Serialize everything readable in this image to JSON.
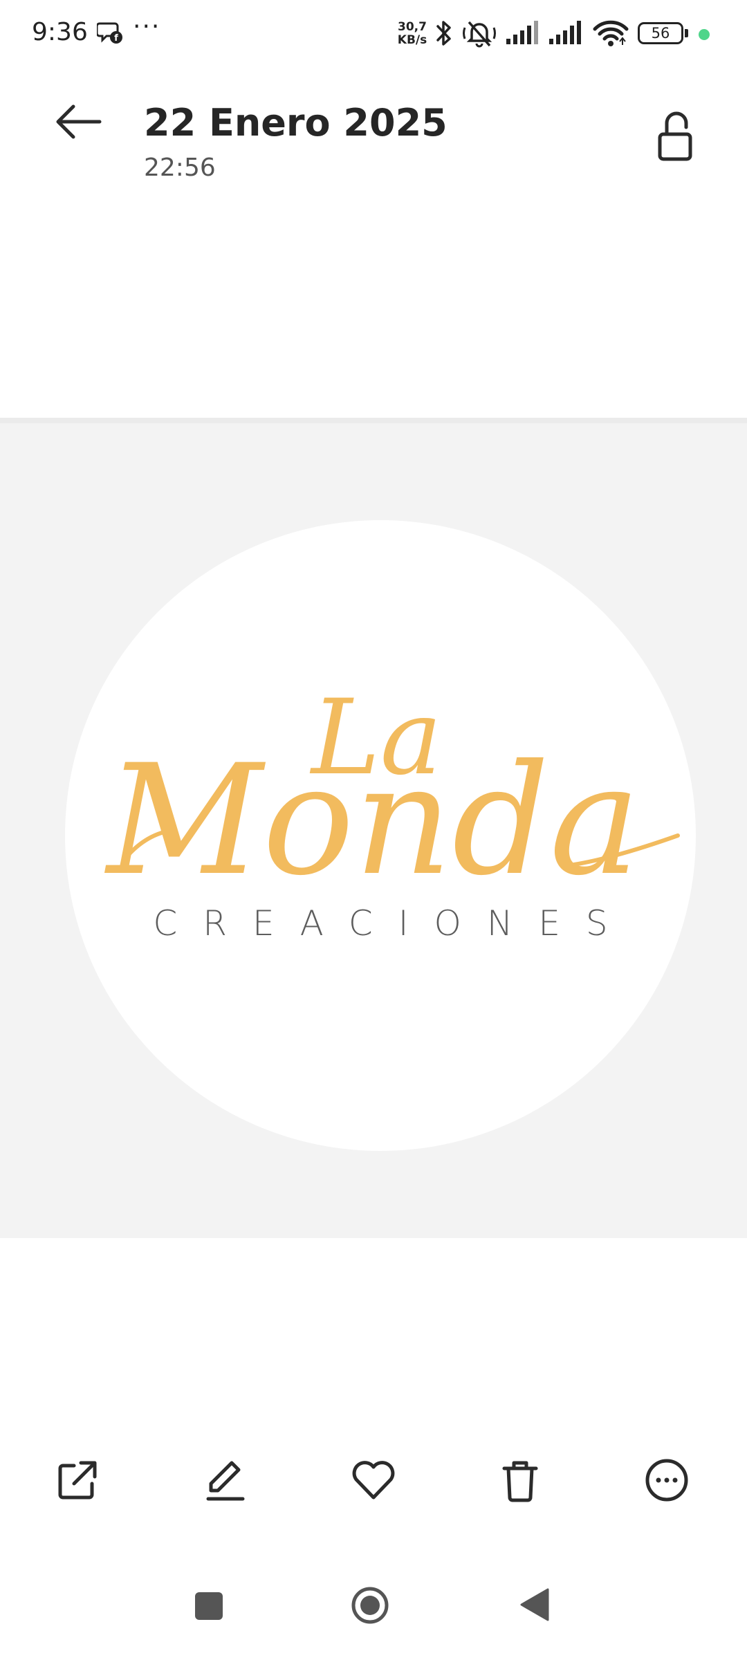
{
  "status_bar": {
    "time": "9:36",
    "overflow": "···",
    "speed_value": "30,7",
    "speed_unit": "KB/s",
    "battery": "56",
    "icons": [
      "notification-icon",
      "bluetooth-icon",
      "mute-icon",
      "signal-icon",
      "wifi-icon",
      "battery-icon"
    ]
  },
  "header": {
    "title": "22 Enero 2025",
    "time": "22:56"
  },
  "photo": {
    "logo_script_top": "La",
    "logo_script_main": "Monda",
    "logo_subtitle": "CREACIONES",
    "logo_color": "#f2bb5e",
    "background": "#f3f3f3"
  },
  "toolbar": {
    "items": [
      "share-icon",
      "edit-icon",
      "favorite-icon",
      "delete-icon",
      "more-icon"
    ]
  },
  "navbar": {
    "items": [
      "recents-button",
      "home-button",
      "back-button"
    ]
  }
}
